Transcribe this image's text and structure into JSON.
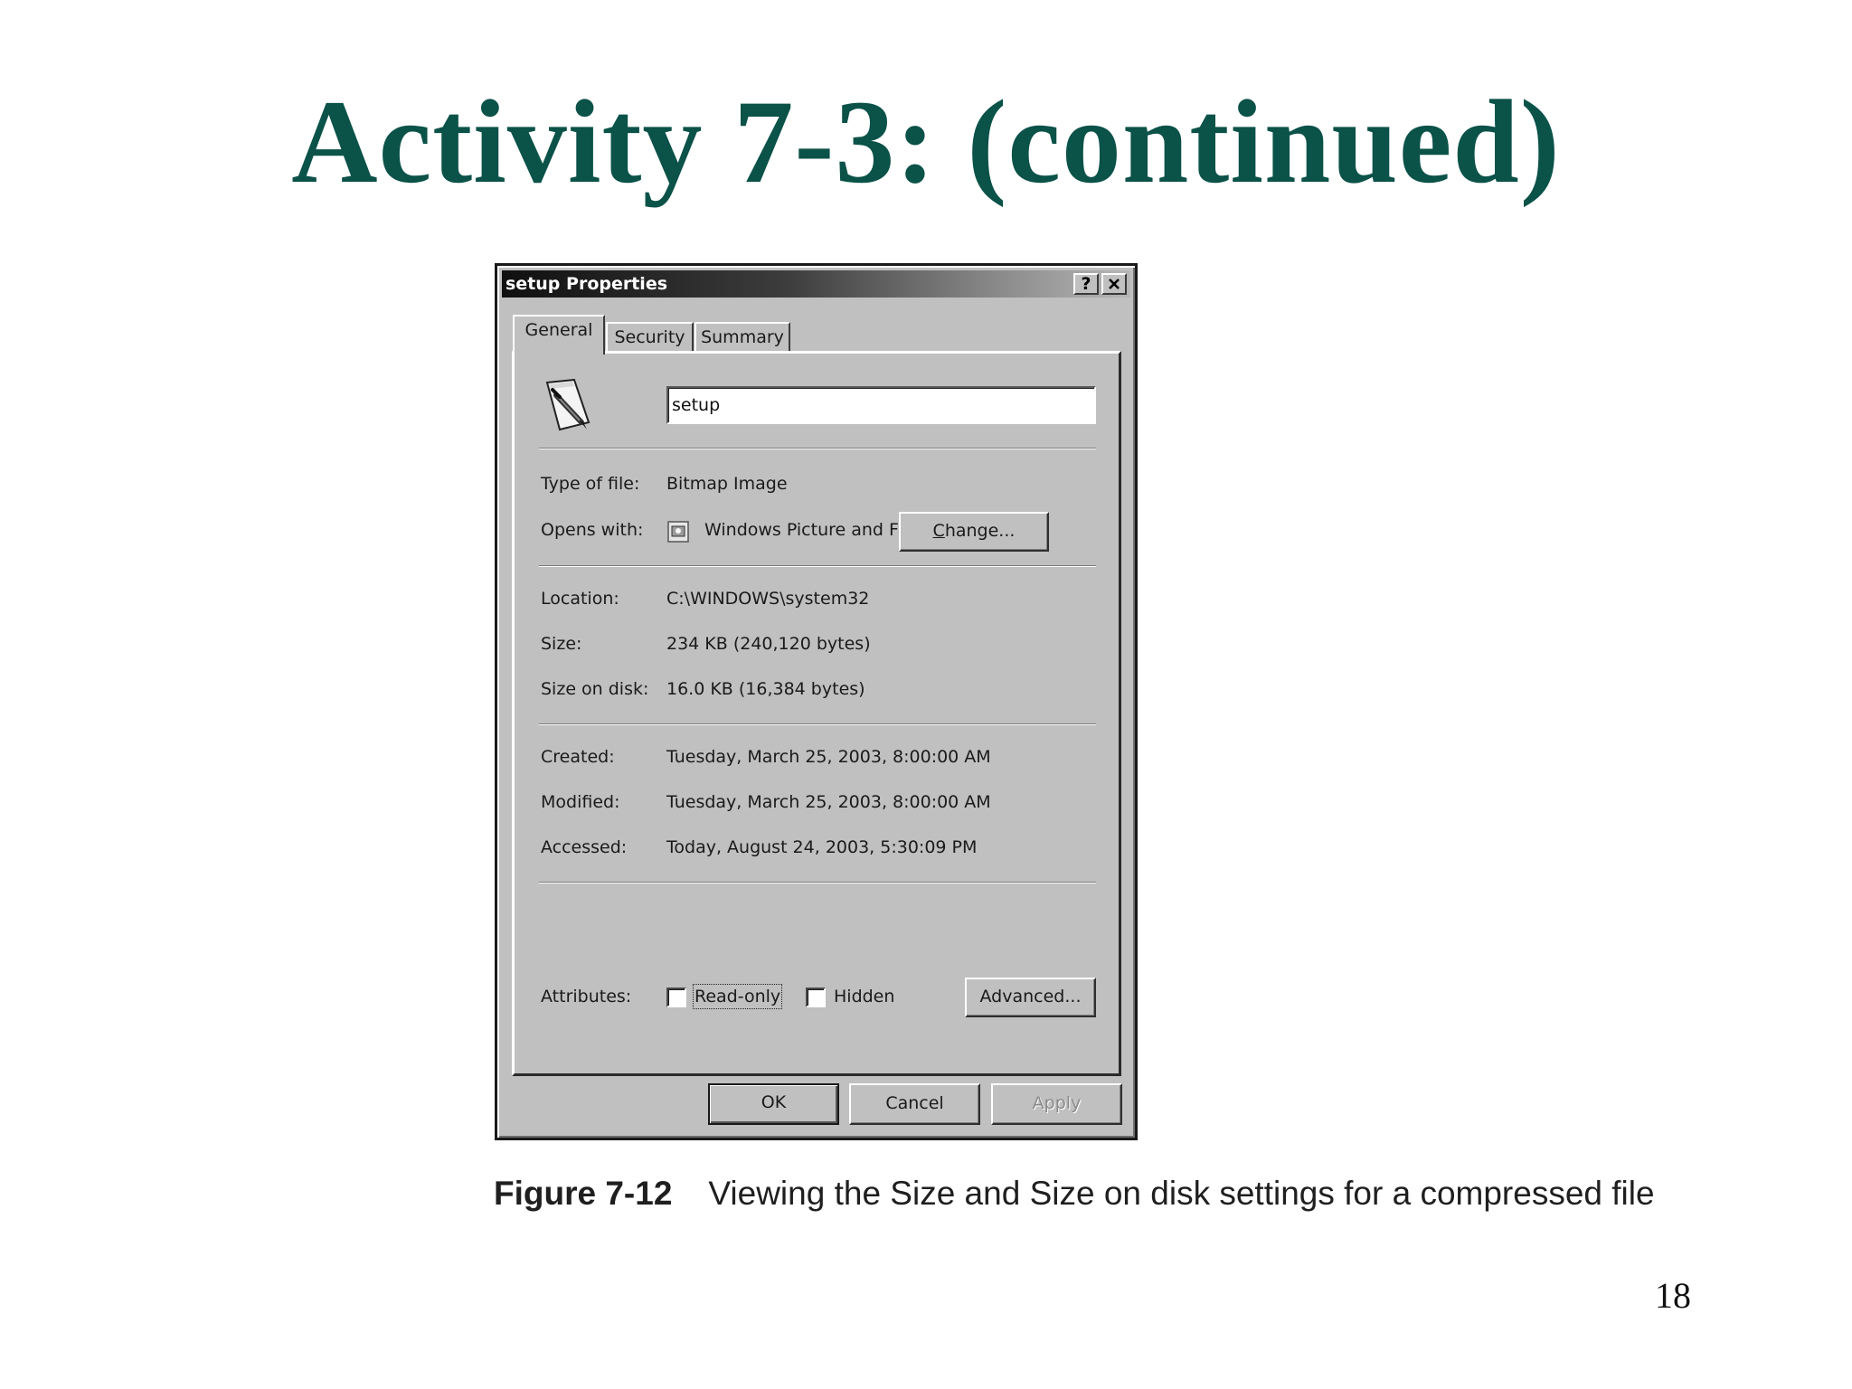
{
  "slide": {
    "title": "Activity 7-3: (continued)",
    "page_number": "18"
  },
  "dialog": {
    "title": "setup Properties",
    "help_button": "?",
    "close_button": "✕",
    "tabs": [
      {
        "label": "General",
        "active": true
      },
      {
        "label": "Security",
        "active": false
      },
      {
        "label": "Summary",
        "active": false
      }
    ],
    "file_icon": "bitmap-file-icon",
    "file_name": "setup",
    "fields": {
      "type_label": "Type of file:",
      "type_value": "Bitmap Image",
      "opens_label": "Opens with:",
      "opens_app": "Windows Picture and F",
      "opens_icon": "windows-picture-viewer-icon",
      "change_button": "Change...",
      "location_label": "Location:",
      "location_value": "C:\\WINDOWS\\system32",
      "size_label": "Size:",
      "size_value": "234 KB (240,120 bytes)",
      "size_on_disk_label": "Size on disk:",
      "size_on_disk_value": "16.0 KB (16,384 bytes)",
      "created_label": "Created:",
      "created_value": "Tuesday, March 25, 2003, 8:00:00 AM",
      "modified_label": "Modified:",
      "modified_value": "Tuesday, March 25, 2003, 8:00:00 AM",
      "accessed_label": "Accessed:",
      "accessed_value": "Today, August 24, 2003, 5:30:09 PM",
      "attributes_label": "Attributes:",
      "readonly_label": "Read-only",
      "readonly_checked": false,
      "hidden_label": "Hidden",
      "hidden_checked": false,
      "advanced_button": "Advanced..."
    },
    "buttons": {
      "ok": "OK",
      "cancel": "Cancel",
      "apply": "Apply",
      "apply_enabled": false
    }
  },
  "caption": {
    "label": "Figure 7-12",
    "text": "Viewing the Size and Size on disk settings for a compressed file"
  }
}
